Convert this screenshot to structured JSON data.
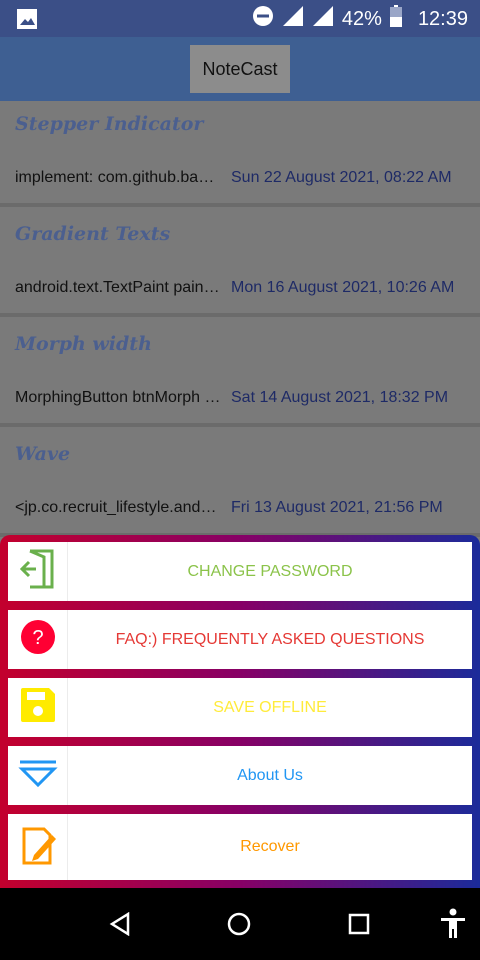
{
  "status_bar": {
    "battery_percent": "42%",
    "time": "12:39",
    "icons": [
      "gallery-icon",
      "do-not-disturb-icon",
      "signal-icon",
      "signal-icon",
      "battery-icon"
    ]
  },
  "app": {
    "title": "NoteCast"
  },
  "notes": [
    {
      "title": "Stepper Indicator",
      "body": "implement: com.github.badoualy:stepper-indicator",
      "date": "Sun 22 August 2021, 08:22 AM"
    },
    {
      "title": "Gradient Texts",
      "body": "android.text.TextPaint paint = textView.getPaint()",
      "date": "Mon 16 August 2021, 10:26 AM"
    },
    {
      "title": "Morph width",
      "body": "MorphingButton btnMorph = findViewById()",
      "date": "Sat 14 August 2021, 18:32 PM"
    },
    {
      "title": "Wave",
      "body": "<jp.co.recruit_lifestyle.android.widget.WaveSwipeRefreshLayout",
      "date": "Fri 13 August 2021, 21:56 PM"
    }
  ],
  "menu": {
    "items": [
      {
        "label": "CHANGE PASSWORD",
        "icon": "logout-door-icon",
        "color": "#8bc34a"
      },
      {
        "label": "FAQ:) FREQUENTLY ASKED QUESTIONS",
        "icon": "question-icon",
        "color": "#e53935"
      },
      {
        "label": "SAVE OFFLINE",
        "icon": "save-floppy-icon",
        "color": "#ffeb3b"
      },
      {
        "label": "About Us",
        "icon": "about-triangle-icon",
        "color": "#2196f3"
      },
      {
        "label": "Recover",
        "icon": "recover-edit-icon",
        "color": "#ff9800"
      }
    ]
  },
  "nav": {
    "items": [
      "back-icon",
      "home-icon",
      "recents-icon",
      "accessibility-icon"
    ]
  },
  "colors": {
    "status_bar": "#3b4f87",
    "app_bar": "#3e5f92",
    "dim_overlay": "#7a7a7a",
    "sheet_gradient": [
      "#c3002d",
      "#870066",
      "#1b2b9a"
    ]
  }
}
